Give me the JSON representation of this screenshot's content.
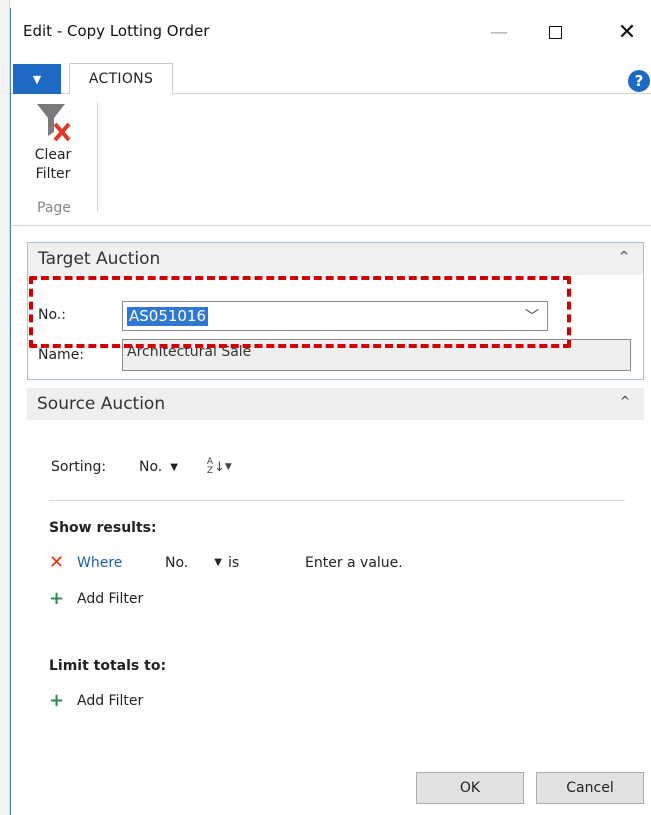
{
  "window": {
    "title": "Edit - Copy Lotting Order"
  },
  "ribbon": {
    "tab_label": "ACTIONS",
    "clear_filter_line1": "Clear",
    "clear_filter_line2": "Filter",
    "group_label": "Page"
  },
  "target_auction": {
    "header": "Target Auction",
    "no_label": "No.:",
    "no_value": "AS051016",
    "name_label": "Name:",
    "name_value": "Architectural Sale"
  },
  "source_auction": {
    "header": "Source Auction",
    "sorting_label": "Sorting:",
    "sorting_field": "No.",
    "show_results_label": "Show results:",
    "where_label": "Where",
    "filter_field": "No.",
    "filter_operator": "is",
    "filter_placeholder": "Enter a value.",
    "add_filter_label": "Add Filter",
    "limit_totals_label": "Limit totals to:",
    "add_filter_label_2": "Add Filter"
  },
  "buttons": {
    "ok": "OK",
    "cancel": "Cancel"
  },
  "colors": {
    "accent_blue": "#1e69c4",
    "highlight_red": "#d40000",
    "selection_blue": "#2f79d4"
  },
  "icons": [
    "app-menu-icon",
    "help-icon",
    "clear-filter-icon",
    "minimize-icon",
    "maximize-icon",
    "close-icon",
    "collapse-icon",
    "sort-az-icon",
    "remove-filter-icon",
    "add-filter-icon"
  ]
}
